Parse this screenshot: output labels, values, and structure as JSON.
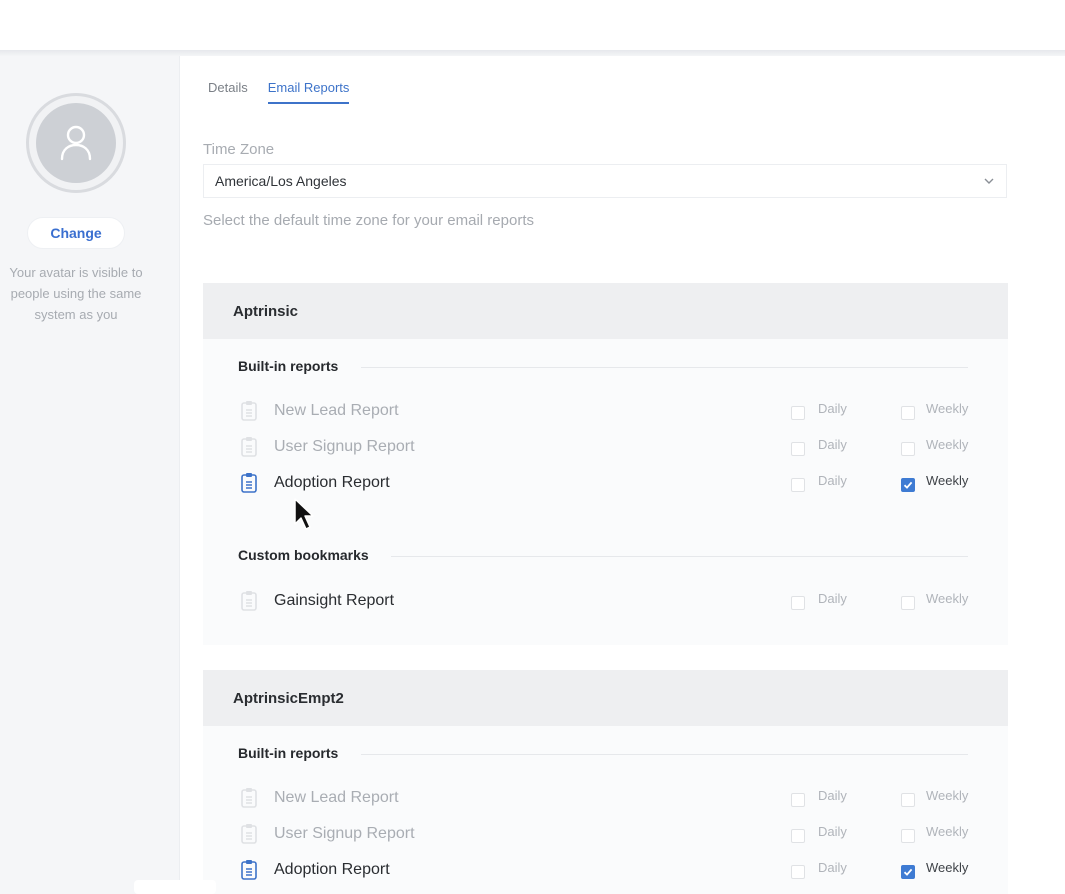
{
  "profile": {
    "change_label": "Change",
    "avatar_note": "Your avatar is visible to people using the same system as you"
  },
  "tabs": [
    {
      "label": "Details",
      "active": false
    },
    {
      "label": "Email Reports",
      "active": true
    }
  ],
  "timezone": {
    "label": "Time Zone",
    "value": "America/Los Angeles",
    "help": "Select the default time zone for your email reports"
  },
  "groups": [
    {
      "name": "Aptrinsic",
      "builtin_title": "Built-in reports",
      "builtin": [
        {
          "name": "New Lead Report",
          "daily": false,
          "weekly": false,
          "active": false
        },
        {
          "name": "User Signup Report",
          "daily": false,
          "weekly": false,
          "active": false
        },
        {
          "name": "Adoption Report",
          "daily": false,
          "weekly": true,
          "active": true
        }
      ],
      "custom_title": "Custom bookmarks",
      "custom": [
        {
          "name": "Gainsight Report",
          "daily": false,
          "weekly": false,
          "active": false
        }
      ]
    },
    {
      "name": "AptrinsicEmpt2",
      "builtin_title": "Built-in reports",
      "builtin": [
        {
          "name": "New Lead Report",
          "daily": false,
          "weekly": false,
          "active": false
        },
        {
          "name": "User Signup Report",
          "daily": false,
          "weekly": false,
          "active": false
        },
        {
          "name": "Adoption Report",
          "daily": false,
          "weekly": true,
          "active": true
        }
      ]
    }
  ],
  "labels": {
    "daily": "Daily",
    "weekly": "Weekly"
  },
  "colors": {
    "accent": "#3d73c9",
    "checkbox_checked": "#3e7bd3",
    "header_bg": "#eeeff1"
  },
  "icons": {
    "avatar": "user-icon",
    "report": "clipboard-icon",
    "select": "chevron-down-icon",
    "cursor": "mouse-pointer-icon"
  }
}
